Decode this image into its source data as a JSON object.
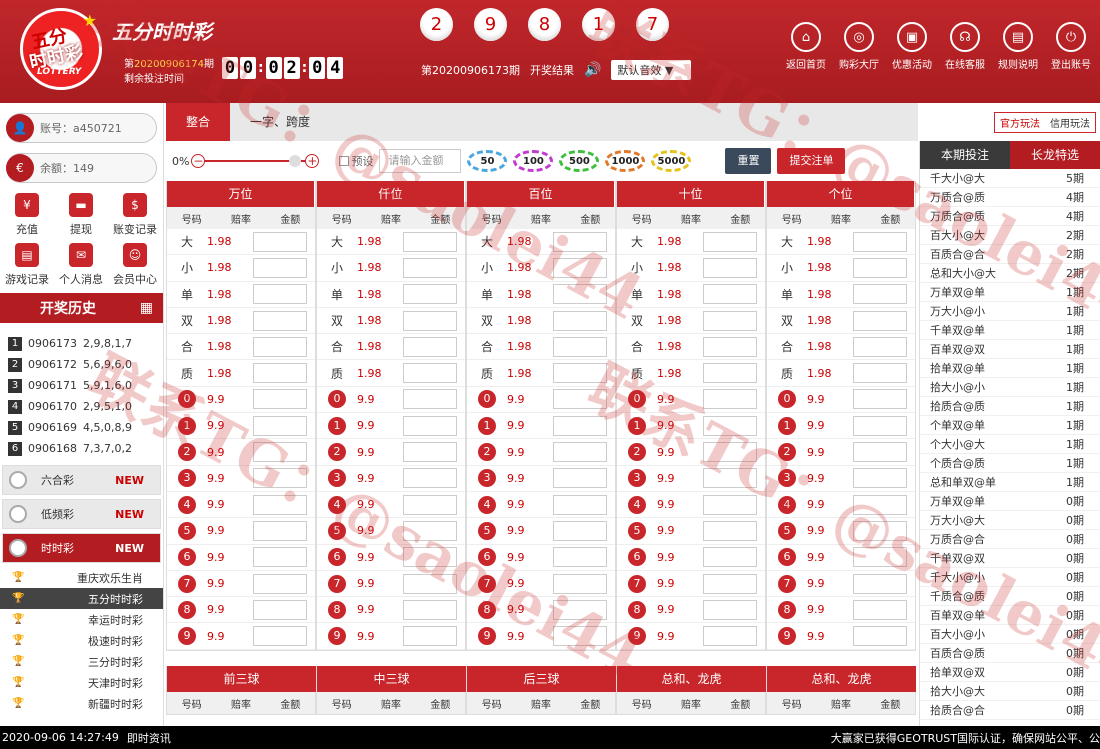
{
  "header": {
    "logo_line1": "五分",
    "logo_line2": "时时彩",
    "logo_sub": "LOTTERY",
    "app_name": "五分时时彩",
    "issue_prefix": "第",
    "issue_number": "20200906174",
    "issue_suffix": "期",
    "remaining_label": "剩余投注时间",
    "countdown": [
      "0",
      "0",
      "0",
      "2",
      "0",
      "4"
    ],
    "draw_balls": [
      "2",
      "9",
      "8",
      "1",
      "7"
    ],
    "last_period": "第20200906173期",
    "result_label": "开奖结果",
    "sound_select": "默认音效"
  },
  "topnav": [
    {
      "label": "返回首页",
      "icon": "⌂"
    },
    {
      "label": "购彩大厅",
      "icon": "◎"
    },
    {
      "label": "优惠活动",
      "icon": "▣"
    },
    {
      "label": "在线客服",
      "icon": "☊"
    },
    {
      "label": "规则说明",
      "icon": "▤"
    },
    {
      "label": "登出账号",
      "icon": "⏻"
    }
  ],
  "account": {
    "username": "账号：a450721",
    "balance": "余额：149"
  },
  "quick": [
    {
      "label": "充值",
      "icon": "¥"
    },
    {
      "label": "提现",
      "icon": "▬"
    },
    {
      "label": "账变记录",
      "icon": "$"
    },
    {
      "label": "游戏记录",
      "icon": "▤"
    },
    {
      "label": "个人消息",
      "icon": "✉"
    },
    {
      "label": "会员中心",
      "icon": "☺"
    }
  ],
  "history": {
    "title": "开奖历史",
    "rows": [
      {
        "i": "1",
        "p": "0906173",
        "r": "2,9,8,1,7"
      },
      {
        "i": "2",
        "p": "0906172",
        "r": "5,6,9,6,0"
      },
      {
        "i": "3",
        "p": "0906171",
        "r": "5,9,1,6,0"
      },
      {
        "i": "4",
        "p": "0906170",
        "r": "2,9,5,1,0"
      },
      {
        "i": "5",
        "p": "0906169",
        "r": "4,5,0,8,9"
      },
      {
        "i": "6",
        "p": "0906168",
        "r": "7,3,7,0,2"
      }
    ]
  },
  "categories": [
    {
      "label": "六合彩",
      "badge": "NEW"
    },
    {
      "label": "低频彩",
      "badge": "NEW"
    },
    {
      "label": "时时彩",
      "badge": "NEW"
    }
  ],
  "subgames": [
    "重庆欢乐生肖",
    "五分时时彩",
    "幸运时时彩",
    "极速时时彩",
    "三分时时彩",
    "天津时时彩",
    "新疆时时彩"
  ],
  "tabs": [
    "整合",
    "一字、跨度"
  ],
  "mode": [
    "官方玩法",
    "信用玩法"
  ],
  "toolbar": {
    "percent": "0%",
    "preset": "预设",
    "amount_placeholder": "请输入金额",
    "chips": [
      "50",
      "100",
      "500",
      "1000",
      "5000"
    ],
    "reset": "重置",
    "submit": "提交注单"
  },
  "columns": [
    "万位",
    "仟位",
    "百位",
    "十位",
    "个位"
  ],
  "subheaders": [
    "号码",
    "赔率",
    "金额"
  ],
  "option_rows": [
    {
      "n": "大",
      "o": "1.98"
    },
    {
      "n": "小",
      "o": "1.98"
    },
    {
      "n": "单",
      "o": "1.98"
    },
    {
      "n": "双",
      "o": "1.98"
    },
    {
      "n": "合",
      "o": "1.98"
    },
    {
      "n": "质",
      "o": "1.98"
    }
  ],
  "num_rows": [
    {
      "n": "0",
      "o": "9.9"
    },
    {
      "n": "1",
      "o": "9.9"
    },
    {
      "n": "2",
      "o": "9.9"
    },
    {
      "n": "3",
      "o": "9.9"
    },
    {
      "n": "4",
      "o": "9.9"
    },
    {
      "n": "5",
      "o": "9.9"
    },
    {
      "n": "6",
      "o": "9.9"
    },
    {
      "n": "7",
      "o": "9.9"
    },
    {
      "n": "8",
      "o": "9.9"
    },
    {
      "n": "9",
      "o": "9.9"
    }
  ],
  "section2": [
    "前三球",
    "中三球",
    "后三球",
    "总和、龙虎",
    "总和、龙虎"
  ],
  "right": {
    "tab1": "本期投注",
    "tab2": "长龙特选",
    "rows": [
      [
        "千大小@大",
        "5期"
      ],
      [
        "万质合@质",
        "4期"
      ],
      [
        "万质合@质",
        "4期"
      ],
      [
        "百大小@大",
        "2期"
      ],
      [
        "百质合@合",
        "2期"
      ],
      [
        "总和大小@大",
        "2期"
      ],
      [
        "万单双@单",
        "1期"
      ],
      [
        "万大小@小",
        "1期"
      ],
      [
        "千单双@单",
        "1期"
      ],
      [
        "百单双@双",
        "1期"
      ],
      [
        "拾单双@单",
        "1期"
      ],
      [
        "拾大小@小",
        "1期"
      ],
      [
        "拾质合@质",
        "1期"
      ],
      [
        "个单双@单",
        "1期"
      ],
      [
        "个大小@大",
        "1期"
      ],
      [
        "个质合@质",
        "1期"
      ],
      [
        "总和单双@单",
        "1期"
      ],
      [
        "万单双@单",
        "0期"
      ],
      [
        "万大小@大",
        "0期"
      ],
      [
        "万质合@合",
        "0期"
      ],
      [
        "千单双@双",
        "0期"
      ],
      [
        "千大小@小",
        "0期"
      ],
      [
        "千质合@质",
        "0期"
      ],
      [
        "百单双@单",
        "0期"
      ],
      [
        "百大小@小",
        "0期"
      ],
      [
        "百质合@质",
        "0期"
      ],
      [
        "拾单双@双",
        "0期"
      ],
      [
        "拾大小@大",
        "0期"
      ],
      [
        "拾质合@合",
        "0期"
      ]
    ]
  },
  "footer": {
    "datetime": "2020-09-06 14:27:49",
    "news_label": "即时资讯",
    "marquee": "大赢家已获得GEOTRUST国际认证，确保网站公平、公"
  },
  "watermark": "联系TG：@saolei44"
}
